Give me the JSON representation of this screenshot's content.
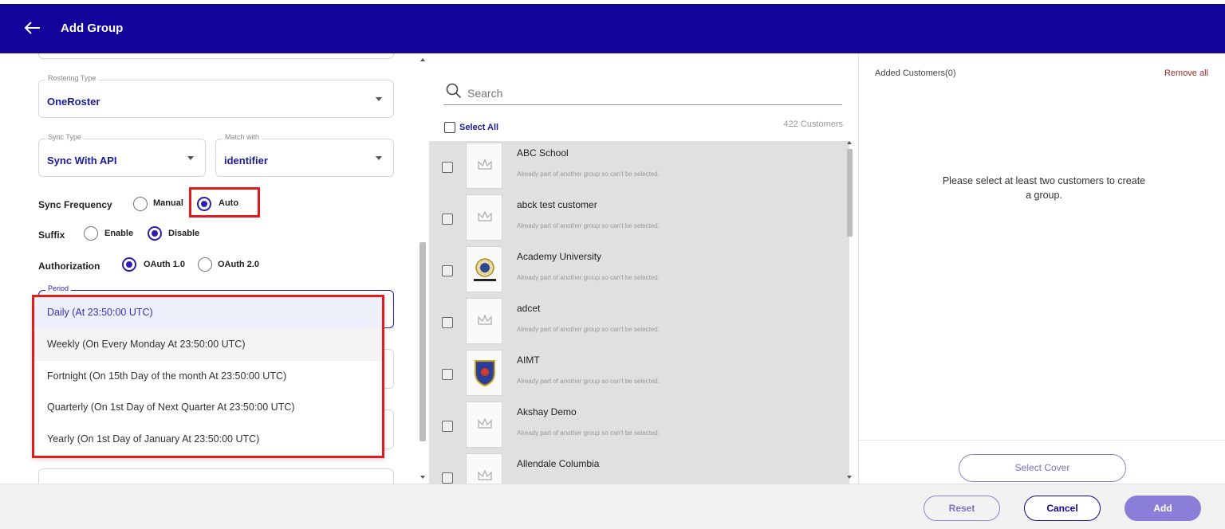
{
  "header": {
    "title": "Add Group"
  },
  "form": {
    "rostering_type": {
      "label": "Rostering Type",
      "value": "OneRoster"
    },
    "sync_type": {
      "label": "Sync Type",
      "value": "Sync With API"
    },
    "match_with": {
      "label": "Match with",
      "value": "identifier"
    },
    "sync_frequency": {
      "label": "Sync Frequency",
      "options": [
        "Manual",
        "Auto"
      ],
      "selected": "Auto"
    },
    "suffix": {
      "label": "Suffix",
      "options": [
        "Enable",
        "Disable"
      ],
      "selected": "Disable"
    },
    "authorization": {
      "label": "Authorization",
      "options": [
        "OAuth 1.0",
        "OAuth 2.0"
      ],
      "selected": "OAuth 1.0"
    },
    "period": {
      "label": "Period",
      "options": [
        "Daily (At 23:50:00 UTC)",
        "Weekly (On Every Monday At 23:50:00 UTC)",
        "Fortnight (On 15th Day of the month At 23:50:00 UTC)",
        "Quarterly (On 1st Day of Next Quarter At 23:50:00 UTC)",
        "Yearly (On 1st Day of January At 23:50:00 UTC)"
      ],
      "selected": "Daily (At 23:50:00 UTC)"
    }
  },
  "customers": {
    "search_placeholder": "Search",
    "select_all_label": "Select All",
    "count_label": "422 Customers",
    "items": [
      {
        "name": "ABC School",
        "note": "Already part of another group so can't be selected."
      },
      {
        "name": "abck test customer",
        "note": "Already part of another group so can't be selected."
      },
      {
        "name": "Academy University",
        "note": "Already part of another group so can't be selected."
      },
      {
        "name": "adcet",
        "note": "Already part of another group so can't be selected."
      },
      {
        "name": "AIMT",
        "note": "Already part of another group so can't be selected."
      },
      {
        "name": "Akshay Demo",
        "note": "Already part of another group so can't be selected."
      },
      {
        "name": "Allendale Columbia",
        "note": ""
      }
    ]
  },
  "added": {
    "label": "Added Customers(0)",
    "remove_all": "Remove all",
    "empty_message": "Please select at least two customers to create a group.",
    "select_cover": "Select Cover"
  },
  "footer": {
    "reset": "Reset",
    "cancel": "Cancel",
    "add": "Add"
  },
  "colors": {
    "header": "#12039a",
    "accent": "#2b1fb0",
    "highlight": "#e21b1b"
  }
}
